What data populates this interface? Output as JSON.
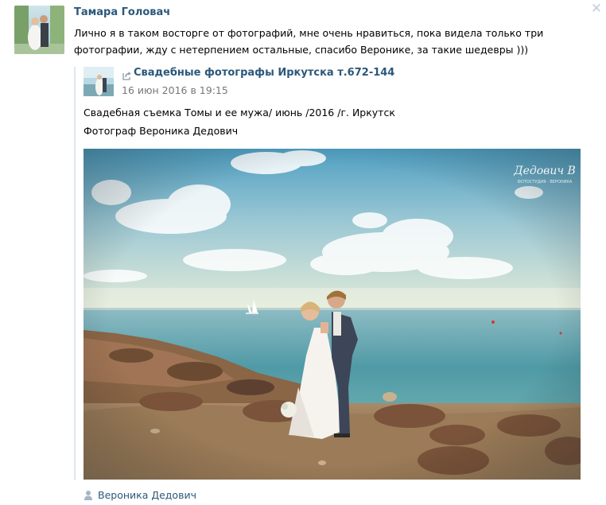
{
  "comment": {
    "author": "Тамара Головач",
    "text": "Лично я в таком восторге от фотографий, мне очень нравиться, пока видела только три фотографии, жду с нетерпением остальные, спасибо Веронике, за такие шедевры )))"
  },
  "repost": {
    "group_name": "Свадебные фотографы Иркутска т.672-144",
    "date": "16 июн 2016 в 19:15",
    "text_line1": "Свадебная съемка Томы и ее мужа/ июнь /2016 /г. Иркутск",
    "text_line2": "Фотограф Вероника Дедович",
    "photo_watermark": "Дедович В",
    "photo_watermark_sub": "ФОТОСТУДИЯ · ВЕРОНИКА",
    "signer": "Вероника Дедович"
  },
  "icons": {
    "close": "close-icon",
    "share": "share-arrow-icon",
    "signer": "person-icon"
  },
  "colors": {
    "link": "#2b587a",
    "date": "#777777",
    "repost_bar": "#dee6ee"
  }
}
